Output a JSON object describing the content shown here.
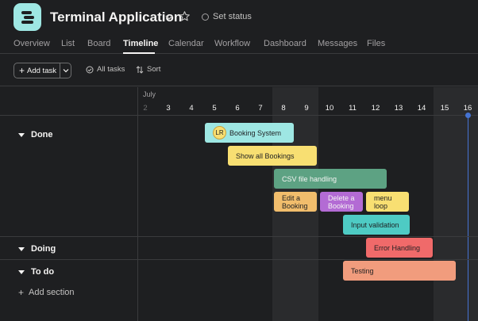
{
  "project": {
    "title": "Terminal Application",
    "status_label": "Set status",
    "colors": {
      "icon": "#9ee7e3",
      "background": "#1e1f21"
    }
  },
  "tabs": [
    {
      "label": "Overview"
    },
    {
      "label": "List"
    },
    {
      "label": "Board"
    },
    {
      "label": "Timeline",
      "active": true
    },
    {
      "label": "Calendar"
    },
    {
      "label": "Workflow"
    },
    {
      "label": "Dashboard"
    },
    {
      "label": "Messages"
    },
    {
      "label": "Files"
    }
  ],
  "toolbar": {
    "add_task": "Add task",
    "all_tasks": "All tasks",
    "sort": "Sort"
  },
  "timeline": {
    "month": "July",
    "days": [
      "2",
      "3",
      "4",
      "5",
      "6",
      "7",
      "8",
      "9",
      "10",
      "11",
      "12",
      "13",
      "14",
      "15",
      "16"
    ],
    "today": "16"
  },
  "sections": [
    {
      "name": "Done"
    },
    {
      "name": "Doing"
    },
    {
      "name": "To do"
    }
  ],
  "add_section": "Add section",
  "tasks": [
    {
      "name": "Booking System",
      "assignee": "LR",
      "color": "#9ee7e3",
      "start": "5",
      "end": "8"
    },
    {
      "name": "Show all Bookings",
      "color": "#f8df72",
      "start": "6",
      "end": "9"
    },
    {
      "name": "CSV file handling",
      "color": "#5da283",
      "start": "8",
      "end": "12"
    },
    {
      "name": "Edit a Booking",
      "color": "#f1bd6c",
      "start": "8",
      "end": "9"
    },
    {
      "name": "Delete a Booking",
      "color": "#b36bd4",
      "start": "10",
      "end": "11"
    },
    {
      "name": "menu loop",
      "color": "#f8df72",
      "start": "12",
      "end": "13"
    },
    {
      "name": "Input validation",
      "color": "#4ecbc4",
      "start": "11",
      "end": "13"
    },
    {
      "name": "Error Handling",
      "color": "#f06a6a",
      "start": "12",
      "end": "14"
    },
    {
      "name": "Testing",
      "color": "#f19c7d",
      "start": "11",
      "end": "15"
    }
  ]
}
